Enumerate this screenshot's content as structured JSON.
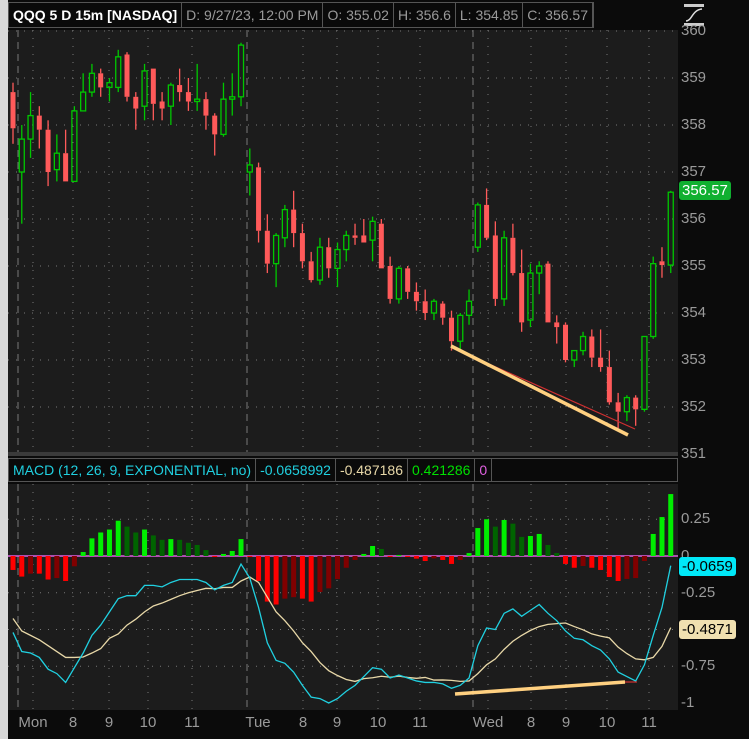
{
  "header": {
    "symbol": "QQQ 5 D 15m [NASDAQ]",
    "date": "D: 9/27/23, 12:00 PM",
    "open": "O: 355.02",
    "high": "H: 356.6",
    "low": "L: 354.85",
    "close": "C: 356.57"
  },
  "macd_header": {
    "title": "MACD (12, 26, 9, EXPONENTIAL, no)",
    "value": "-0.0658992",
    "avg": "-0.487186",
    "diff": "0.421286",
    "zero": "0"
  },
  "price_axis": {
    "labels": [
      "360",
      "359",
      "358",
      "357",
      "356",
      "355",
      "354",
      "353",
      "352",
      "351"
    ],
    "last_price_badge": "356.57"
  },
  "macd_axis": {
    "labels": [
      "0.25",
      "0",
      "-0.25",
      "-0.75",
      "-1"
    ],
    "value_badge": "-0.0659",
    "avg_badge": "-0.4871"
  },
  "x_axis": {
    "labels": [
      "Mon",
      "8",
      "9",
      "10",
      "11",
      "Tue",
      "8",
      "9",
      "10",
      "11",
      "Wed",
      "8",
      "9",
      "10",
      "11"
    ]
  },
  "colors": {
    "up": "#00c800",
    "down": "#ff5a5a",
    "macd": "#20d0e0",
    "avg": "#e8d8a8",
    "hist_up": "#00ee00",
    "hist_up_weak": "#006400",
    "hist_down": "#ff0000",
    "hist_down_weak": "#800000",
    "zero": "#e060e0",
    "trend": "#ffd080",
    "badge_green": "#10b030"
  },
  "chart_data": [
    {
      "type": "candlestick",
      "title": "QQQ 5 D 15m [NASDAQ]",
      "ylim": [
        351,
        360
      ],
      "ohlc": [
        [
          358.7,
          358.9,
          357.6,
          357.93
        ],
        [
          357.0,
          358.0,
          355.9,
          357.7
        ],
        [
          357.7,
          358.7,
          357.3,
          358.2
        ],
        [
          358.2,
          358.4,
          357.5,
          357.9
        ],
        [
          357.9,
          358.1,
          356.7,
          357.0
        ],
        [
          357.05,
          357.8,
          356.8,
          357.4
        ],
        [
          357.4,
          357.9,
          356.8,
          356.8
        ],
        [
          356.8,
          358.4,
          356.8,
          358.3
        ],
        [
          358.3,
          359.1,
          358.3,
          358.7
        ],
        [
          358.7,
          359.3,
          358.6,
          359.1
        ],
        [
          359.1,
          359.2,
          358.6,
          358.8
        ],
        [
          358.8,
          359.0,
          358.5,
          358.9
        ],
        [
          358.8,
          359.6,
          358.7,
          359.45
        ],
        [
          359.5,
          359.55,
          358.5,
          358.6
        ],
        [
          358.6,
          358.7,
          357.9,
          358.35
        ],
        [
          358.4,
          359.3,
          358.1,
          359.15
        ],
        [
          359.2,
          359.2,
          358.1,
          358.45
        ],
        [
          358.5,
          358.7,
          358.1,
          358.35
        ],
        [
          358.4,
          358.9,
          358.0,
          358.85
        ],
        [
          358.85,
          359.2,
          358.5,
          358.7
        ],
        [
          358.7,
          359.0,
          358.3,
          358.5
        ],
        [
          358.5,
          359.3,
          358.3,
          358.55
        ],
        [
          358.55,
          358.7,
          357.9,
          358.2
        ],
        [
          358.2,
          358.25,
          357.35,
          357.8
        ],
        [
          357.8,
          358.9,
          357.75,
          358.55
        ],
        [
          358.55,
          359.1,
          358.2,
          358.6
        ],
        [
          358.6,
          359.75,
          358.4,
          359.7
        ],
        [
          357.0,
          357.5,
          356.5,
          357.15
        ],
        [
          357.1,
          357.2,
          355.5,
          355.75
        ],
        [
          355.75,
          356.1,
          354.85,
          355.05
        ],
        [
          355.05,
          355.7,
          354.55,
          355.65
        ],
        [
          355.6,
          356.3,
          355.4,
          356.2
        ],
        [
          356.2,
          356.6,
          355.4,
          355.7
        ],
        [
          355.7,
          355.9,
          354.95,
          355.1
        ],
        [
          355.1,
          355.3,
          354.65,
          354.7
        ],
        [
          354.7,
          355.6,
          354.6,
          355.4
        ],
        [
          355.4,
          355.6,
          354.75,
          354.95
        ],
        [
          354.95,
          355.5,
          354.55,
          355.35
        ],
        [
          355.35,
          355.75,
          355.1,
          355.65
        ],
        [
          355.65,
          355.9,
          355.45,
          355.6
        ],
        [
          355.65,
          356.0,
          355.5,
          355.5
        ],
        [
          355.55,
          356.05,
          355.1,
          355.95
        ],
        [
          355.9,
          356.0,
          354.95,
          354.95
        ],
        [
          355.0,
          355.2,
          354.2,
          354.3
        ],
        [
          354.3,
          355.0,
          354.2,
          354.95
        ],
        [
          354.95,
          355.0,
          354.3,
          354.45
        ],
        [
          354.45,
          354.65,
          354.05,
          354.25
        ],
        [
          354.25,
          354.5,
          353.85,
          354.0
        ],
        [
          354.0,
          354.3,
          353.85,
          354.25
        ],
        [
          354.2,
          354.25,
          353.75,
          353.9
        ],
        [
          353.9,
          354.05,
          353.2,
          353.4
        ],
        [
          353.4,
          354.0,
          353.2,
          353.95
        ],
        [
          353.95,
          354.5,
          353.75,
          354.25
        ],
        [
          355.4,
          356.35,
          355.3,
          356.3
        ],
        [
          356.3,
          356.65,
          355.55,
          355.6
        ],
        [
          355.65,
          355.95,
          354.15,
          354.3
        ],
        [
          354.3,
          355.75,
          354.15,
          355.6
        ],
        [
          355.6,
          355.9,
          354.8,
          354.85
        ],
        [
          354.85,
          355.35,
          353.6,
          353.8
        ],
        [
          353.85,
          355.05,
          353.7,
          354.85
        ],
        [
          354.85,
          355.1,
          354.4,
          355.0
        ],
        [
          355.05,
          355.1,
          353.8,
          353.8
        ],
        [
          353.8,
          353.95,
          353.35,
          353.7
        ],
        [
          353.75,
          353.8,
          352.95,
          353.0
        ],
        [
          353.0,
          353.2,
          352.85,
          353.2
        ],
        [
          353.2,
          353.6,
          353.1,
          353.5
        ],
        [
          353.5,
          353.65,
          352.85,
          353.05
        ],
        [
          353.05,
          353.65,
          352.75,
          352.85
        ],
        [
          352.85,
          353.2,
          352.05,
          352.1
        ],
        [
          352.1,
          352.3,
          351.55,
          351.9
        ],
        [
          351.9,
          352.25,
          351.7,
          352.2
        ],
        [
          352.2,
          352.25,
          351.6,
          351.95
        ],
        [
          351.95,
          353.5,
          351.9,
          353.5
        ],
        [
          353.5,
          355.2,
          353.45,
          355.05
        ],
        [
          355.1,
          355.4,
          354.75,
          355.02
        ],
        [
          355.02,
          356.6,
          354.85,
          356.57
        ]
      ]
    },
    {
      "type": "macd",
      "title": "MACD (12, 26, 9, EXPONENTIAL, no)",
      "ylim": [
        -1,
        0.45
      ],
      "macd": [
        -0.52,
        -0.65,
        -0.66,
        -0.69,
        -0.77,
        -0.8,
        -0.86,
        -0.76,
        -0.66,
        -0.54,
        -0.47,
        -0.38,
        -0.29,
        -0.27,
        -0.27,
        -0.2,
        -0.2,
        -0.21,
        -0.18,
        -0.16,
        -0.16,
        -0.16,
        -0.18,
        -0.23,
        -0.2,
        -0.18,
        -0.055,
        -0.15,
        -0.35,
        -0.59,
        -0.71,
        -0.73,
        -0.79,
        -0.88,
        -0.96,
        -0.97,
        -1.0,
        -0.97,
        -0.92,
        -0.88,
        -0.82,
        -0.76,
        -0.77,
        -0.83,
        -0.81,
        -0.83,
        -0.85,
        -0.86,
        -0.86,
        -0.87,
        -0.9,
        -0.88,
        -0.83,
        -0.61,
        -0.49,
        -0.5,
        -0.39,
        -0.36,
        -0.41,
        -0.37,
        -0.33,
        -0.39,
        -0.44,
        -0.51,
        -0.56,
        -0.57,
        -0.61,
        -0.64,
        -0.7,
        -0.79,
        -0.82,
        -0.85,
        -0.74,
        -0.54,
        -0.35,
        -0.0659
      ],
      "hist": [
        -0.095,
        -0.14,
        -0.12,
        -0.12,
        -0.16,
        -0.15,
        -0.17,
        -0.07,
        0.027,
        0.12,
        0.16,
        0.18,
        0.24,
        0.2,
        0.16,
        0.18,
        0.14,
        0.11,
        0.115,
        0.11,
        0.09,
        0.075,
        0.04,
        -0.007,
        0.014,
        0.034,
        0.115,
        -0.007,
        -0.17,
        -0.31,
        -0.33,
        -0.29,
        -0.28,
        -0.29,
        -0.31,
        -0.245,
        -0.22,
        -0.157,
        -0.08,
        -0.027,
        0.014,
        0.068,
        0.048,
        -0.005,
        0.007,
        -0.004,
        -0.018,
        -0.034,
        -0.016,
        -0.027,
        -0.054,
        -0.027,
        0.02,
        0.19,
        0.25,
        0.2,
        0.245,
        0.22,
        0.13,
        0.136,
        0.15,
        0.075,
        0.02,
        -0.054,
        -0.08,
        -0.068,
        -0.08,
        -0.095,
        -0.143,
        -0.17,
        -0.156,
        -0.15,
        -0.034,
        0.15,
        0.265,
        0.4213
      ]
    }
  ]
}
